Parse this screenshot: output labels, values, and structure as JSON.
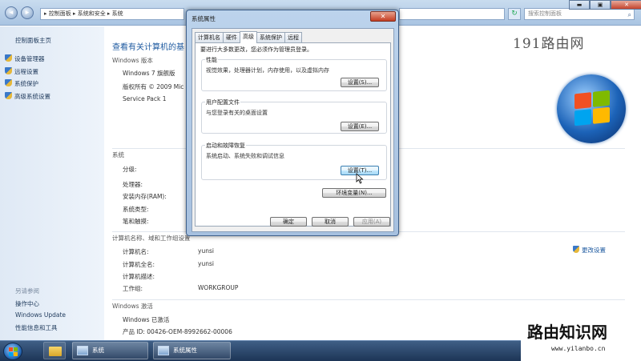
{
  "explorer": {
    "address": "▸ 控制面板 ▸ 系统和安全 ▸ 系统",
    "search_placeholder": "搜索控制面板",
    "window_controls": {
      "minimize": "▬",
      "maximize": "▣",
      "close": "✕"
    }
  },
  "leftnav": {
    "home": "控制面板主页",
    "links": [
      "设备管理器",
      "远程设置",
      "系统保护",
      "高级系统设置"
    ],
    "see_also_header": "另请参阅",
    "see_also": [
      "操作中心",
      "Windows Update",
      "性能信息和工具"
    ]
  },
  "main": {
    "title": "查看有关计算机的基",
    "edition_header": "Windows 版本",
    "edition": "Windows 7 旗舰版",
    "copyright": "版权所有 © 2009 Mic",
    "service_pack": "Service Pack 1",
    "system_header": "系统",
    "system_labels": [
      "分级:",
      "处理器:",
      "安装内存(RAM):",
      "系统类型:",
      "笔和触摸:"
    ],
    "name_header": "计算机名称、域和工作组设置",
    "name_rows": [
      {
        "label": "计算机名:",
        "value": "yunsi"
      },
      {
        "label": "计算机全名:",
        "value": "yunsi"
      },
      {
        "label": "计算机描述:",
        "value": ""
      },
      {
        "label": "工作组:",
        "value": "WORKGROUP"
      }
    ],
    "change_settings": "更改设置",
    "activation_header": "Windows 激活",
    "activation_status": "Windows 已激活",
    "product_id": "产品 ID: 00426-OEM-8992662-00006"
  },
  "dialog": {
    "title": "系统属性",
    "close": "✕",
    "tabs": [
      "计算机名",
      "硬件",
      "高级",
      "系统保护",
      "远程"
    ],
    "active_tab": "高级",
    "admin_note": "要进行大多数更改，您必须作为管理员登录。",
    "groups": [
      {
        "label": "性能",
        "desc": "视觉效果，处理器计划，内存使用，以及虚拟内存",
        "button": "设置(S)..."
      },
      {
        "label": "用户配置文件",
        "desc": "与您登录有关的桌面设置",
        "button": "设置(E)..."
      },
      {
        "label": "启动和故障恢复",
        "desc": "系统启动、系统失败和调试信息",
        "button": "设置(T)..."
      }
    ],
    "env_button": "环境变量(N)...",
    "ok": "确定",
    "cancel": "取消",
    "apply": "应用(A)"
  },
  "watermark": {
    "top": "191路由网",
    "bottom": "路由知识网",
    "url": "www.yilanbo.cn"
  },
  "taskbar": {
    "items": [
      "系统",
      "系统属性"
    ]
  },
  "colors": {
    "accent": "#1e5aa0",
    "taskbar": "#1d3556",
    "dialog_frame": "#a6c0df"
  }
}
